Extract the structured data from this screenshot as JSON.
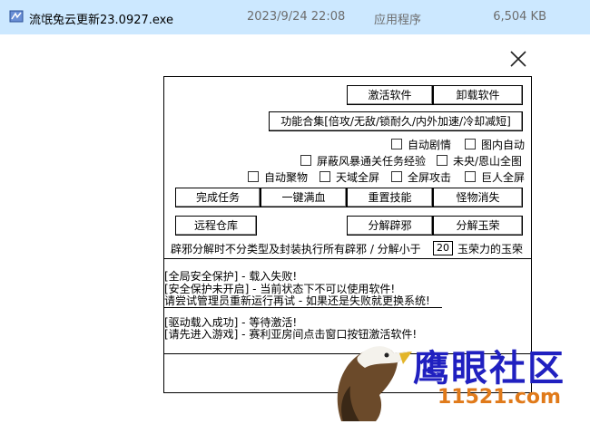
{
  "file": {
    "name": "流氓兔云更新23.0927.exe",
    "date": "2023/9/24 22:08",
    "type": "应用程序",
    "size": "6,504 KB"
  },
  "buttons": {
    "activate": "激活软件",
    "uninstall": "卸载软件",
    "combo": "功能合集[倍攻/无敌/锁耐久/内外加速/冷却减短]",
    "complete_task": "完成任务",
    "one_key_full_hp": "一键满血",
    "reset_skill": "重置技能",
    "monster_vanish": "怪物消失",
    "remote_warehouse": "远程仓库",
    "decompose_evil": "分解辟邪",
    "decompose_jade": "分解玉荣"
  },
  "checkboxes": {
    "auto_plot": "自动剧情",
    "map_auto": "图内自动",
    "block_storm": "屏蔽风暴通关任务经验",
    "weiyang_map": "未央/恩山全图",
    "auto_gather": "自动聚物",
    "sky_fullscreen": "天域全屏",
    "fullscreen_attack": "全屏攻击",
    "giant_fullscreen": "巨人全屏"
  },
  "decompose": {
    "text_prefix": "辟邪分解时不分类型及封装执行所有辟邪 / 分解小于",
    "value": "20",
    "text_suffix": "玉荣力的玉荣"
  },
  "log": {
    "line1": "[全局安全保护] - 载入失败!",
    "line2": "[安全保护未开启] - 当前状态下不可以使用软件!",
    "line3": "请尝试管理员重新运行再试 - 如果还是失败就更换系统!",
    "line4": "[驱动载入成功] - 等待激活!",
    "line5": "[请先进入游戏] - 赛利亚房间点击窗口按钮激活软件!"
  },
  "watermark": {
    "title": "鹰眼社区",
    "url": "11521.com"
  }
}
